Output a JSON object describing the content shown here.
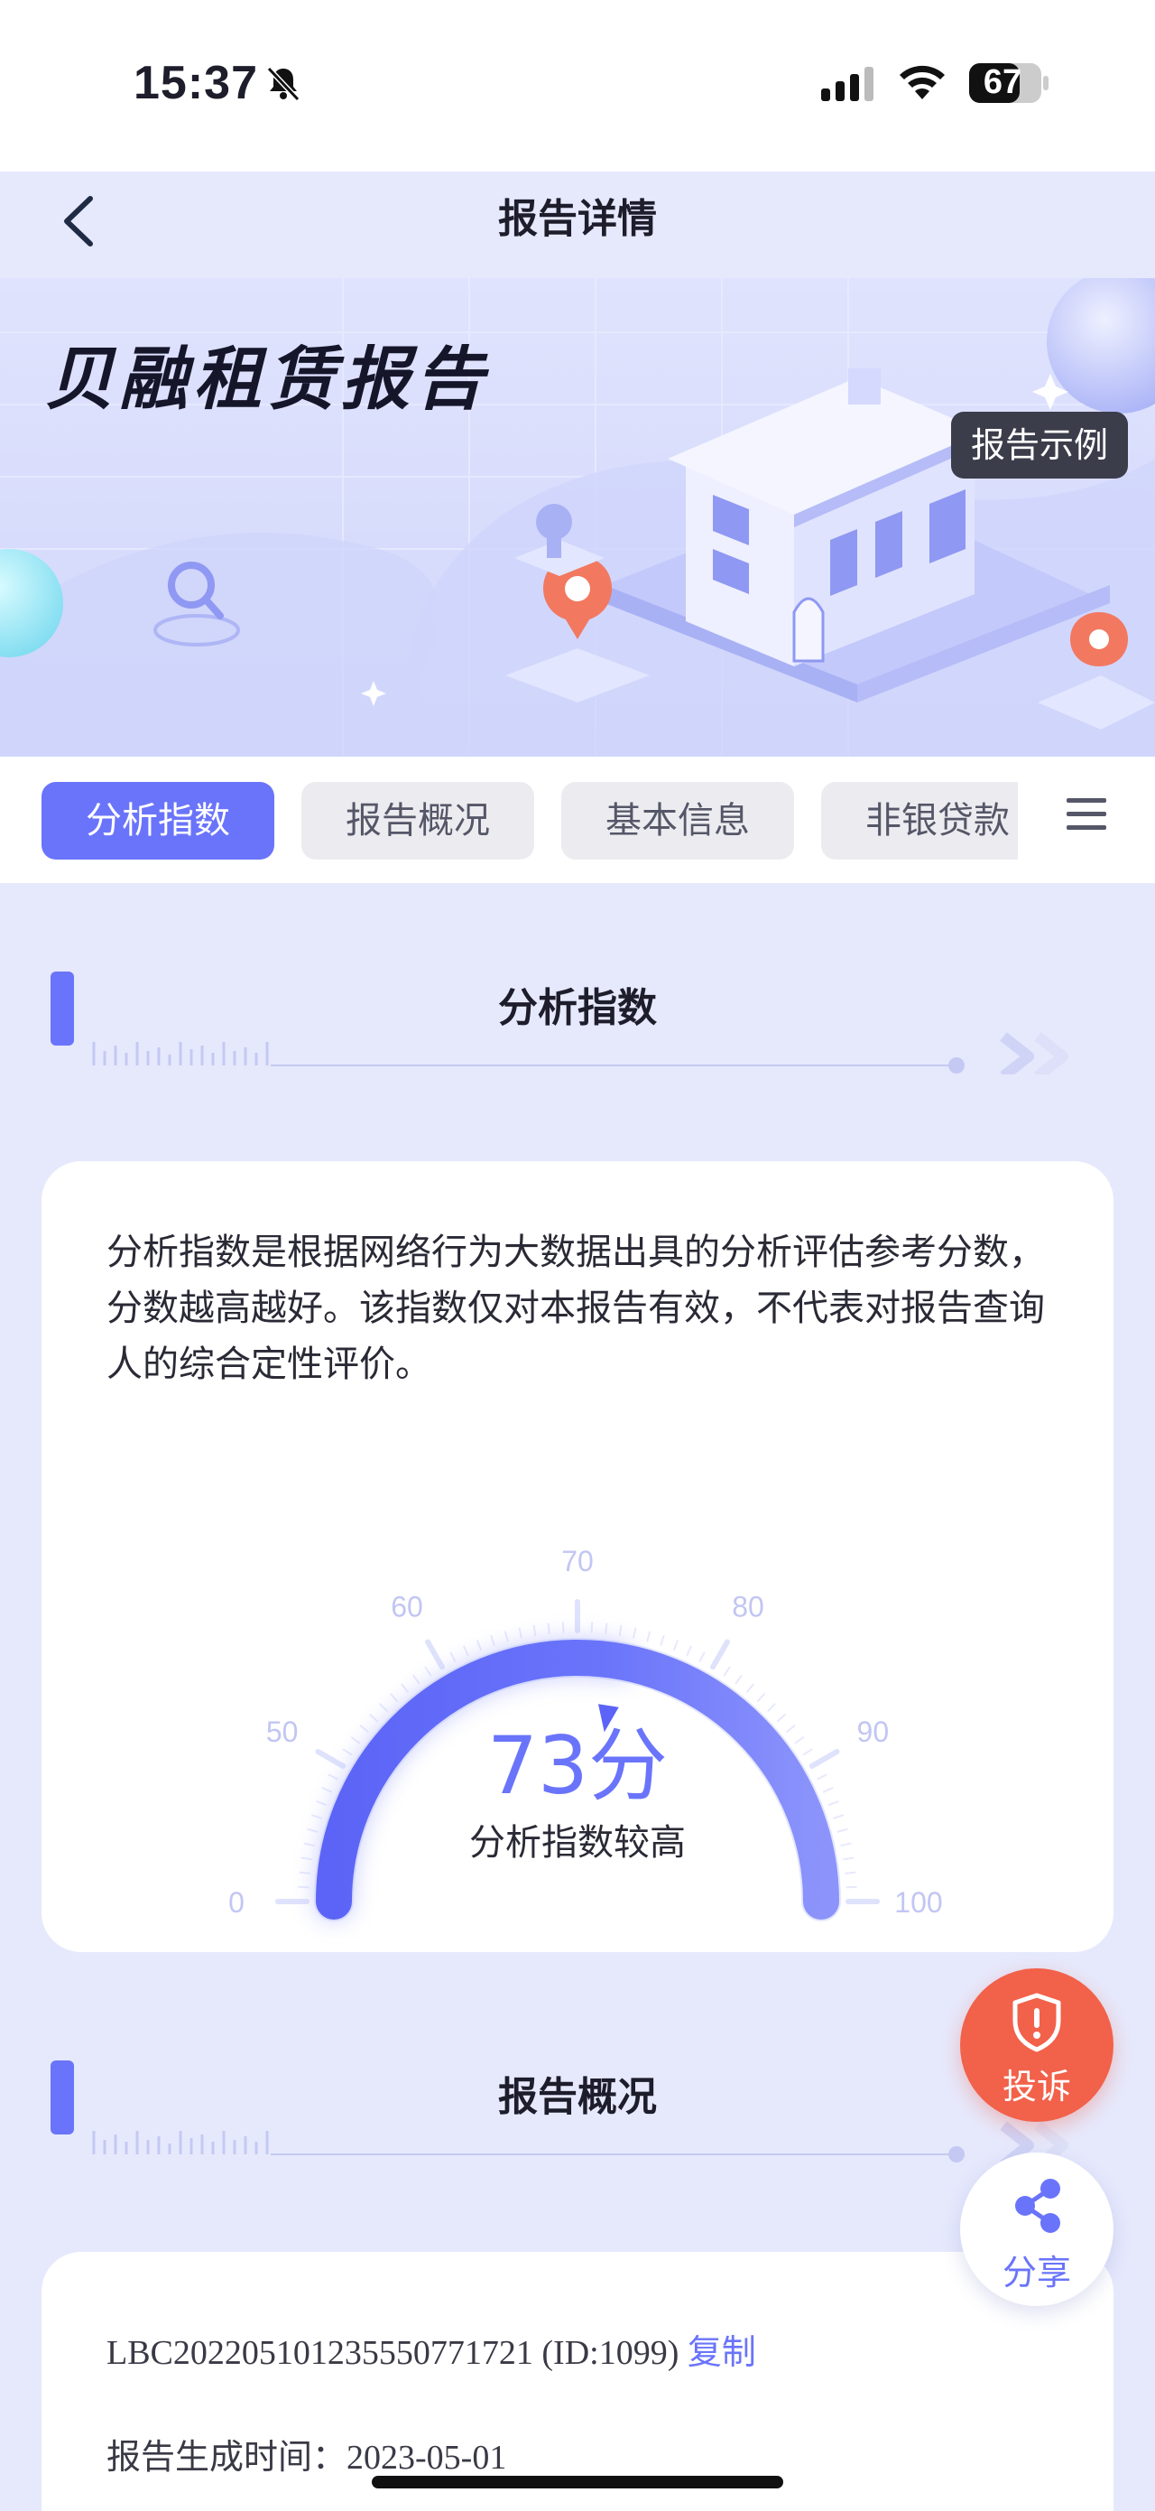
{
  "status_bar": {
    "time": "15:37",
    "battery": "67"
  },
  "nav": {
    "title": "报告详情"
  },
  "hero": {
    "title": "贝融租赁报告",
    "sample_button": "报告示例"
  },
  "tabs": [
    {
      "label": "分析指数",
      "active": true
    },
    {
      "label": "报告概况",
      "active": false
    },
    {
      "label": "基本信息",
      "active": false
    },
    {
      "label": "非银贷款",
      "active": false
    }
  ],
  "analysis": {
    "section_title": "分析指数",
    "description": "分析指数是根据网络行为大数据出具的分析评估参考分数，分数越高越好。该指数仅对本报告有效，不代表对报告查询人的综合定性评价。",
    "gauge": {
      "value": 73,
      "ticks": [
        "0",
        "50",
        "60",
        "70",
        "80",
        "90",
        "100"
      ],
      "score_text": "73分",
      "score_label": "分析指数较高"
    }
  },
  "overview": {
    "section_title": "报告概况",
    "report_id": "LBC202205101235550771721 (ID:1099)",
    "copy_label": "复制",
    "generated_label": "报告生成时间：",
    "generated_value": "2023-05-01"
  },
  "floating": {
    "complain_label": "投诉",
    "share_label": "分享"
  },
  "colors": {
    "accent": "#6a74fa",
    "complain": "#f2614a",
    "background": "#e6e9fc"
  },
  "icons": [
    "back-icon",
    "bell-slash-icon",
    "signal-icon",
    "wifi-icon",
    "battery-icon",
    "menu-icon",
    "shield-alert-icon",
    "share-icon"
  ]
}
